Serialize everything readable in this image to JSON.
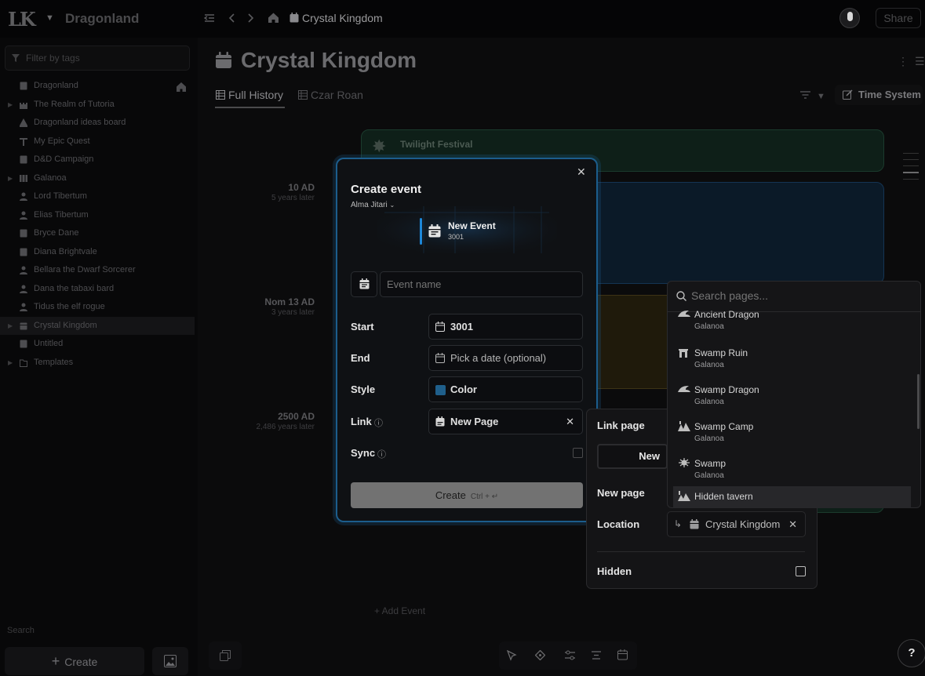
{
  "topbar": {
    "logo": "LK",
    "workspace": "Dragonland",
    "breadcrumb": "Crystal Kingdom",
    "share": "Share"
  },
  "sidebar": {
    "filter_placeholder": "Filter by tags",
    "items": [
      {
        "label": "Dragonland",
        "icon": "page-icon"
      },
      {
        "label": "The Realm of Tutoria",
        "icon": "castle-icon"
      },
      {
        "label": "Dragonland ideas board",
        "icon": "board-icon"
      },
      {
        "label": "My Epic Quest",
        "icon": "quest-icon"
      },
      {
        "label": "D&D Campaign",
        "icon": "page-icon"
      },
      {
        "label": "Galanoa",
        "icon": "map-icon"
      },
      {
        "label": "Lord Tibertum",
        "icon": "person-icon"
      },
      {
        "label": "Elias Tibertum",
        "icon": "person-icon"
      },
      {
        "label": "Bryce Dane",
        "icon": "page-icon"
      },
      {
        "label": "Diana Brightvale",
        "icon": "page-icon"
      },
      {
        "label": "Bellara the Dwarf Sorcerer",
        "icon": "person-icon"
      },
      {
        "label": "Dana the tabaxi bard",
        "icon": "person-icon"
      },
      {
        "label": "Tidus the elf rogue",
        "icon": "person-icon"
      },
      {
        "label": "Crystal Kingdom",
        "icon": "calendar-icon"
      },
      {
        "label": "Untitled",
        "icon": "page-icon"
      },
      {
        "label": "Templates",
        "icon": "folder-icon"
      }
    ],
    "search_label": "Search",
    "create_label": "Create"
  },
  "main": {
    "title": "Crystal Kingdom",
    "tabs": [
      "Full History",
      "Czar Roan"
    ],
    "time_system": "Time System",
    "timeline": [
      {
        "time": "10 AD",
        "sub": "5 years later"
      },
      {
        "time": "Nom 13 AD",
        "sub": "3 years later"
      },
      {
        "time": "2500 AD",
        "sub": "2,486 years later"
      }
    ],
    "festival_title": "Twilight Festival",
    "add_event": "+ Add Event"
  },
  "modal": {
    "title": "Create event",
    "author": "Alma Jitari",
    "preview_title": "New Event",
    "preview_sub": "3001",
    "event_name_placeholder": "Event name",
    "start_label": "Start",
    "start_value": "3001",
    "end_label": "End",
    "end_placeholder": "Pick a date (optional)",
    "style_label": "Style",
    "style_value": "Color",
    "style_color": "#1f5f8b",
    "link_label": "Link",
    "link_value": "New Page",
    "sync_label": "Sync",
    "create_label": "Create",
    "shortcut": "Ctrl + ↵"
  },
  "link_panel": {
    "link_page_label": "Link page",
    "new_button": "New",
    "new_page_label": "New page",
    "location_label": "Location",
    "location_value": "Crystal Kingdom",
    "hidden_label": "Hidden"
  },
  "search": {
    "placeholder": "Search pages...",
    "results": [
      {
        "name": "Ancient Dragon",
        "sub": "Galanoa",
        "icon": "dragon-icon"
      },
      {
        "name": "Swamp Ruin",
        "sub": "Galanoa",
        "icon": "ruin-icon"
      },
      {
        "name": "Swamp Dragon",
        "sub": "Galanoa",
        "icon": "dragon-icon"
      },
      {
        "name": "Swamp Camp",
        "sub": "Galanoa",
        "icon": "camp-icon"
      },
      {
        "name": "Swamp",
        "sub": "Galanoa",
        "icon": "swamp-icon"
      },
      {
        "name": "Hidden tavern",
        "sub": "",
        "icon": "tavern-icon"
      }
    ]
  },
  "colors": {
    "accent": "#1c5d8c",
    "preview_bar": "#1d87d8"
  }
}
